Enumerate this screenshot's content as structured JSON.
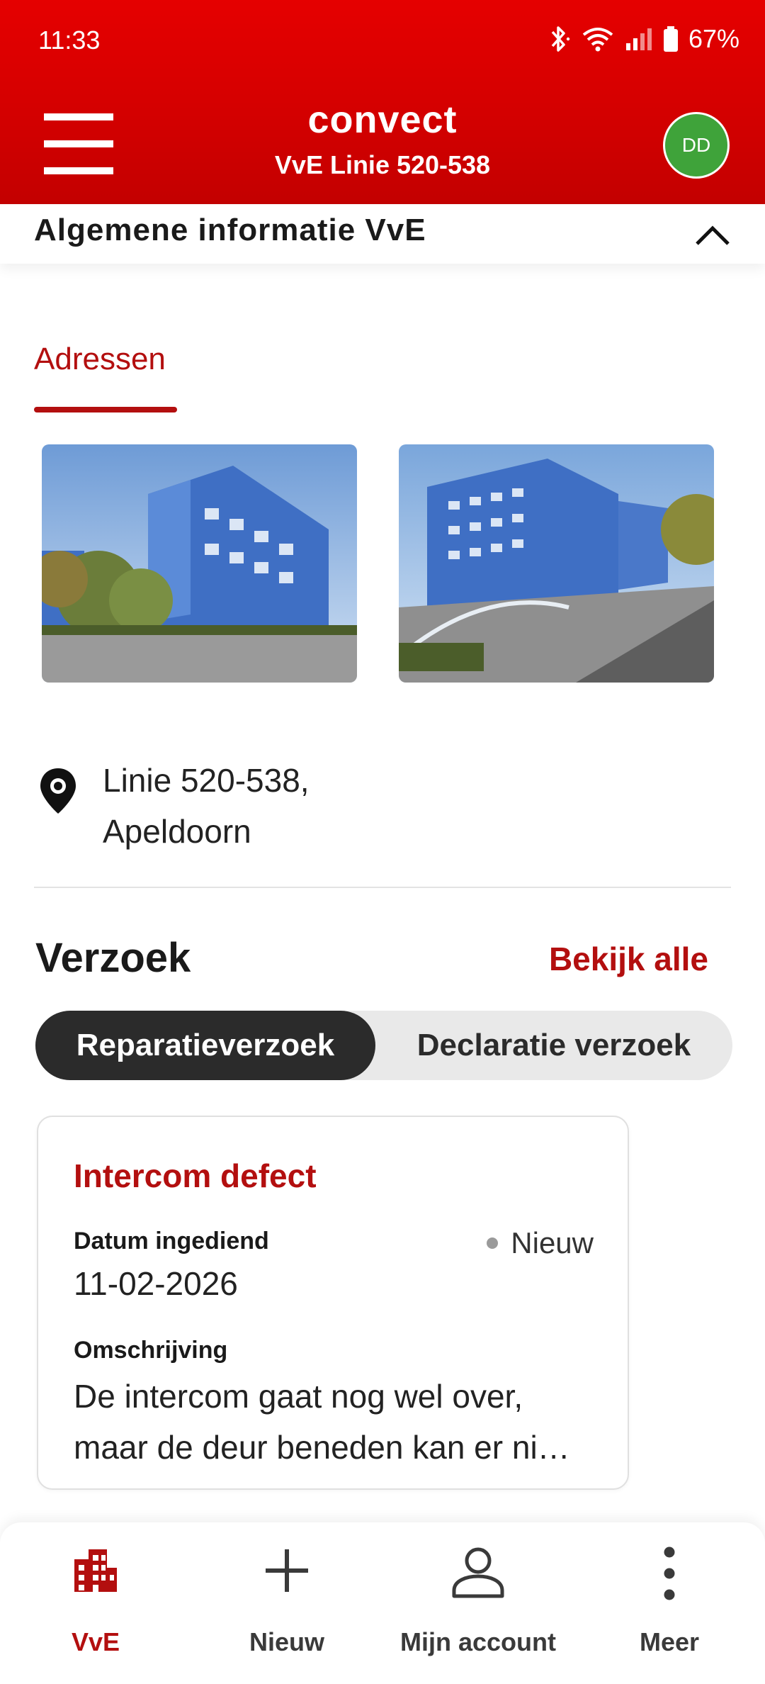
{
  "status_bar": {
    "time": "11:33",
    "battery": "67%"
  },
  "header": {
    "logo": "convect",
    "vve_name": "VvE Linie 520-538",
    "avatar_initials": "DD"
  },
  "section": {
    "title": "Algemene informatie VvE"
  },
  "tabs": [
    {
      "label": "Adressen",
      "active": true
    }
  ],
  "address": {
    "line1": "Linie 520-538,",
    "line2": "Apeldoorn"
  },
  "verzoek": {
    "title": "Verzoek",
    "view_all": "Bekijk alle",
    "segments": [
      {
        "label": "Reparatieverzoek",
        "active": true
      },
      {
        "label": "Declaratie verzoek",
        "active": false
      }
    ],
    "card": {
      "title": "Intercom defect",
      "date_label": "Datum ingediend",
      "date_value": "11-02-2026",
      "status": "Nieuw",
      "desc_label": "Omschrijving",
      "description": "De intercom gaat nog wel over, maar de deur beneden kan er ni…"
    }
  },
  "bottom_nav": [
    {
      "label": "VvE",
      "icon": "building-icon",
      "active": true
    },
    {
      "label": "Nieuw",
      "icon": "plus-icon",
      "active": false
    },
    {
      "label": "Mijn account",
      "icon": "person-icon",
      "active": false
    },
    {
      "label": "Meer",
      "icon": "more-vertical-icon",
      "active": false
    }
  ],
  "colors": {
    "brand_red": "#d40000",
    "accent_red": "#b30f0f",
    "avatar_green": "#3fa33a"
  }
}
